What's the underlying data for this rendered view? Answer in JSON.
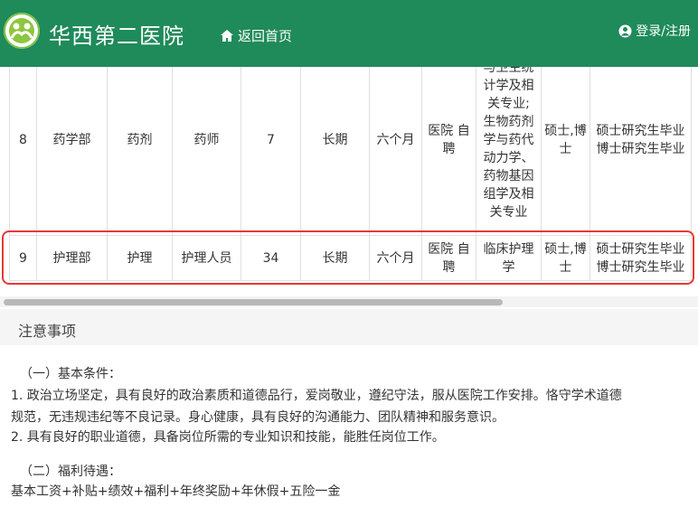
{
  "header": {
    "site_title": "华西第二医院",
    "home_label": "返回首页",
    "login_label": "登录/注册",
    "bg_color": "#1f8a5a"
  },
  "table": {
    "rows": [
      {
        "no": "8",
        "dept": "药学部",
        "category": "药剂",
        "position": "药师",
        "count": "7",
        "term": "长期",
        "probation": "六个月",
        "method": [
          "医院 自",
          "聘"
        ],
        "major": [
          "与卫生统",
          "计学及相",
          "关专业;",
          "生物药剂",
          "学与药代",
          "动力学、",
          "药物基因",
          "组学及相",
          "关专业"
        ],
        "degree": [
          "硕士,博",
          "士"
        ],
        "education": [
          "硕士研究生毕业",
          "博士研究生毕业"
        ]
      },
      {
        "no": "9",
        "dept": "护理部",
        "category": "护理",
        "position": "护理人员",
        "count": "34",
        "term": "长期",
        "probation": "六个月",
        "method": [
          "医院 自",
          "聘"
        ],
        "major": [
          "临床护理",
          "学"
        ],
        "degree": [
          "硕士,博",
          "士"
        ],
        "education": [
          "硕士研究生毕业",
          "博士研究生毕业"
        ]
      }
    ]
  },
  "notice": {
    "title": "注意事项",
    "lines": [
      "（一）基本条件：",
      "1. 政治立场坚定，具有良好的政治素质和道德品行，爱岗敬业，遵纪守法，服从医院工作安排。恪守学术道德",
      "规范，无违规违纪等不良记录。身心健康，具有良好的沟通能力、团队精神和服务意识。",
      "2. 具有良好的职业道德，具备岗位所需的专业知识和技能，能胜任岗位工作。",
      "（二）福利待遇：",
      "基本工资+补贴+绩效+福利+年终奖励+年休假+五险一金"
    ]
  }
}
